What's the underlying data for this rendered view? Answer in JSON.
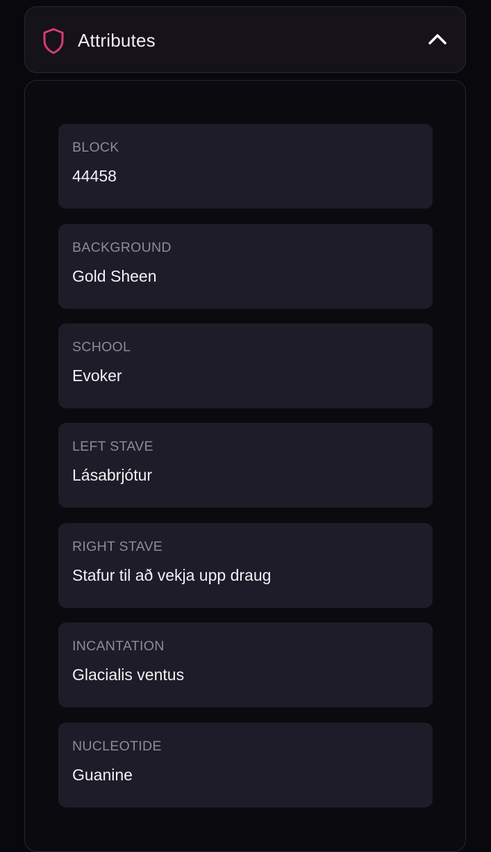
{
  "header": {
    "title": "Attributes",
    "icon": "shield-icon",
    "toggle_icon": "chevron-up-icon",
    "accent_color": "#d93a7c"
  },
  "attributes": [
    {
      "label": "BLOCK",
      "value": "44458"
    },
    {
      "label": "BACKGROUND",
      "value": "Gold Sheen"
    },
    {
      "label": "SCHOOL",
      "value": "Evoker"
    },
    {
      "label": "LEFT STAVE",
      "value": "Lásabrjótur"
    },
    {
      "label": "RIGHT STAVE",
      "value": "Stafur til að vekja upp draug"
    },
    {
      "label": "INCANTATION",
      "value": "Glacialis ventus"
    },
    {
      "label": "NUCLEOTIDE",
      "value": "Guanine"
    }
  ]
}
